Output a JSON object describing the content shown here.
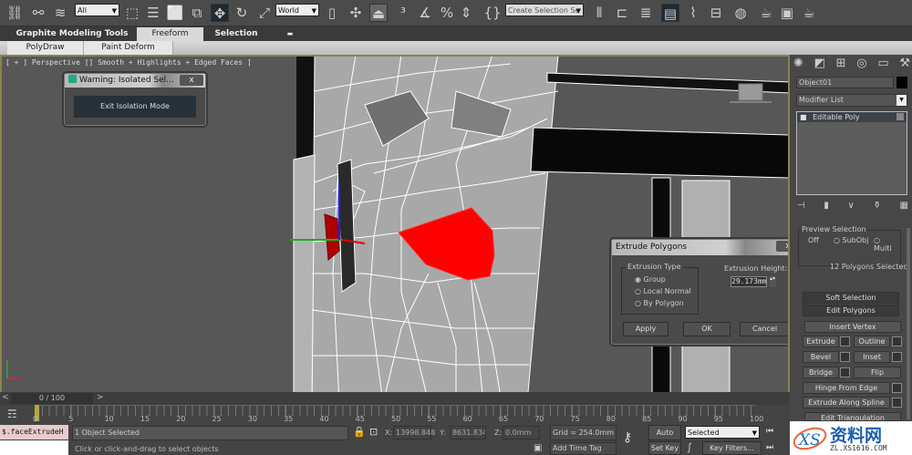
{
  "toolbar": {
    "selection_filter": "All",
    "coord_system": "World",
    "named_selection_placeholder": "Create Selection Se",
    "icons": [
      "link-icon",
      "unlink-icon",
      "bind-space-warp-icon",
      "select-object-icon",
      "select-by-name-icon",
      "rect-selection-icon",
      "window-crossing-icon",
      "move-icon",
      "rotate-icon",
      "scale-icon",
      "use-pivot-icon",
      "manipulate-icon",
      "keyboard-shortcut-icon",
      "snap-3d-icon",
      "angle-snap-icon",
      "percent-snap-icon",
      "spinner-snap-icon",
      "edit-named-sets-icon",
      "mirror-icon",
      "align-icon",
      "layer-manager-icon",
      "graphite-toggle-icon",
      "curve-editor-icon",
      "schematic-view-icon",
      "material-editor-icon",
      "render-setup-icon",
      "rendered-frame-icon",
      "render-teapot-icon"
    ]
  },
  "ribbon": {
    "tabs": [
      "Graphite Modeling Tools",
      "Freeform",
      "Selection"
    ],
    "active_tab": "Freeform",
    "sub_tabs": [
      "PolyDraw",
      "Paint Deform"
    ]
  },
  "viewport": {
    "label": "[ + ] Perspective [] Smooth + Highlights + Edged Faces ]",
    "selection_color": "#ff0000",
    "border_color": "#8c8250"
  },
  "isolation_dialog": {
    "title": "Warning: Isolated Sel...",
    "close": "x",
    "button": "Exit Isolation Mode"
  },
  "extrude_dialog": {
    "title": "Extrude Polygons",
    "close": "x",
    "type_group_label": "Extrusion Type",
    "options": [
      "Group",
      "Local Normal",
      "By Polygon"
    ],
    "selected_option": "Group",
    "height_label": "Extrusion Height:",
    "height_value": "29.173mm",
    "buttons": [
      "Apply",
      "OK",
      "Cancel"
    ]
  },
  "command_panel": {
    "tabs": [
      "create-icon",
      "modify-icon",
      "hierarchy-icon",
      "motion-icon",
      "display-icon",
      "utilities-icon"
    ],
    "object_name": "Object01",
    "modifier_list": "Modifier List",
    "stack_items": [
      "Editable Poly"
    ],
    "preview_selection": {
      "label": "Preview Selection",
      "options": [
        "Off",
        "SubObj",
        "Multi"
      ]
    },
    "selection_info": "12 Polygons Selected",
    "rollouts": [
      "Soft Selection",
      "Edit Polygons"
    ],
    "buttons": {
      "insert_vertex": "Insert Vertex",
      "extrude": "Extrude",
      "outline": "Outline",
      "bevel": "Bevel",
      "inset": "Inset",
      "bridge": "Bridge",
      "flip": "Flip",
      "hinge": "Hinge From Edge",
      "extrude_spline": "Extrude Along Spline",
      "edit_triangulation": "Edit Triangulation"
    }
  },
  "timeline": {
    "frame_display": "0 / 100",
    "prev": "<",
    "next": ">",
    "current_frame": 0,
    "ticks": [
      "0",
      "5",
      "10",
      "15",
      "20",
      "25",
      "30",
      "35",
      "40",
      "45",
      "50",
      "55",
      "60",
      "65",
      "70",
      "75",
      "80",
      "85",
      "90",
      "95",
      "100"
    ]
  },
  "status_bar": {
    "maxscript": "$.faceExtrudeH",
    "selection": "1 Object Selected",
    "prompt": "Click or click-and-drag to select objects",
    "x_label": "X:",
    "x_value": "13998.848",
    "y_label": "Y:",
    "y_value": "8631.834m",
    "z_label": "Z:",
    "z_value": "0.0mm",
    "grid": "Grid = 254.0mm",
    "add_time_tag": "Add Time Tag",
    "auto_key": "Auto Key",
    "set_key": "Set Key",
    "key_mode": "Selected",
    "key_filters": "Key Filters..."
  },
  "watermark": {
    "text": "资料网",
    "url": "ZL.XS1616.COM"
  }
}
